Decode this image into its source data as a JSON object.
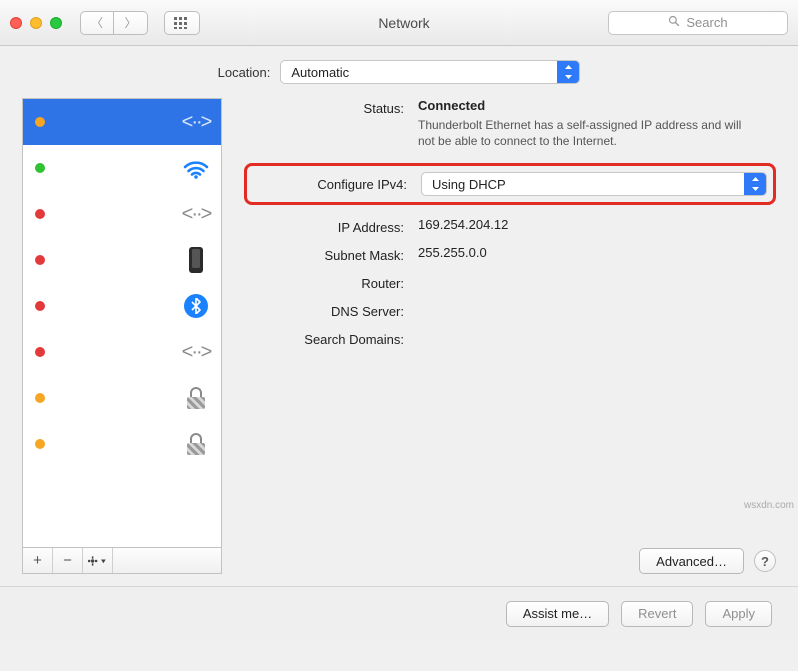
{
  "titlebar": {
    "title": "Network",
    "search_placeholder": "Search"
  },
  "location": {
    "label": "Location:",
    "value": "Automatic"
  },
  "sidebar": {
    "items": [
      {
        "status": "self",
        "icon": "ethernet",
        "selected": true
      },
      {
        "status": "on",
        "icon": "wifi",
        "selected": false
      },
      {
        "status": "off",
        "icon": "ethernet",
        "selected": false
      },
      {
        "status": "off",
        "icon": "phone",
        "selected": false
      },
      {
        "status": "off",
        "icon": "bluetooth",
        "selected": false
      },
      {
        "status": "off",
        "icon": "ethernet",
        "selected": false
      },
      {
        "status": "self",
        "icon": "lock",
        "selected": false
      },
      {
        "status": "self",
        "icon": "lock",
        "selected": false
      }
    ],
    "actions": {
      "add": "+",
      "remove": "−",
      "gear": "⚙"
    }
  },
  "details": {
    "status_label": "Status:",
    "status_value": "Connected",
    "status_desc": "Thunderbolt Ethernet has a self-assigned IP address and will not be able to connect to the Internet.",
    "configure_label": "Configure IPv4:",
    "configure_value": "Using DHCP",
    "ip_label": "IP Address:",
    "ip_value": "169.254.204.12",
    "mask_label": "Subnet Mask:",
    "mask_value": "255.255.0.0",
    "router_label": "Router:",
    "router_value": "",
    "dns_label": "DNS Server:",
    "dns_value": "",
    "search_label": "Search Domains:",
    "search_value": "",
    "advanced_btn": "Advanced…",
    "help": "?"
  },
  "footer": {
    "assist": "Assist me…",
    "revert": "Revert",
    "apply": "Apply"
  },
  "watermark": "wsxdn.com"
}
